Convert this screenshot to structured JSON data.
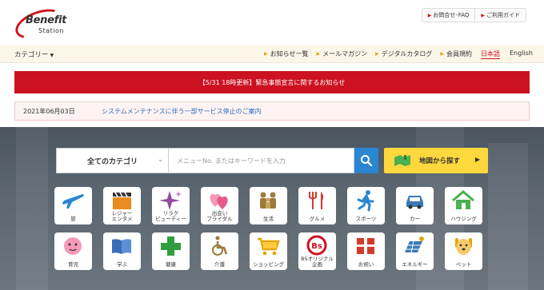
{
  "header": {
    "logo_main": "Benefit",
    "logo_sub": "Station",
    "links": [
      "お問合せ･FAQ",
      "ご利用ガイド"
    ]
  },
  "nav": {
    "category": "カテゴリー",
    "items": [
      "お知らせ一覧",
      "メールマガジン",
      "デジタルカタログ",
      "会員規約"
    ],
    "lang_ja": "日本語",
    "lang_en": "English"
  },
  "alert": {
    "text": "【5/31 18時更新】緊急事態宣言に関するお知らせ"
  },
  "notice": {
    "date": "2021年06月03日",
    "text": "システムメンテナンスに伴う一部サービス停止のご案内"
  },
  "search": {
    "category": "全てのカテゴリ",
    "placeholder": "メニューNo. またはキーワードを入力",
    "map_button": "地図から探す"
  },
  "categories": [
    {
      "label": "旅",
      "icon": "airplane-icon",
      "color": "#2a86d1"
    },
    {
      "label": "レジャー\nエンタメ",
      "icon": "clapperboard-icon",
      "color": "#e98b1e"
    },
    {
      "label": "リラク\nビューティー",
      "icon": "sparkle-icon",
      "color": "#8e4ba0"
    },
    {
      "label": "出会い\nブライダル",
      "icon": "hearts-icon",
      "color": "#e95a8c"
    },
    {
      "label": "生活",
      "icon": "family-icon",
      "color": "#9b7b3a"
    },
    {
      "label": "グルメ",
      "icon": "fork-knife-icon",
      "color": "#d33a2c"
    },
    {
      "label": "スポーツ",
      "icon": "runner-icon",
      "color": "#2a86d1"
    },
    {
      "label": "カー",
      "icon": "car-icon",
      "color": "#3a7ab8"
    },
    {
      "label": "ハウジング",
      "icon": "house-icon",
      "color": "#4caf50"
    },
    {
      "label": "育児",
      "icon": "baby-icon",
      "color": "#e95a8c"
    },
    {
      "label": "学ぶ",
      "icon": "book-icon",
      "color": "#3a6db8"
    },
    {
      "label": "健康",
      "icon": "cross-icon",
      "color": "#2e9e3e"
    },
    {
      "label": "介護",
      "icon": "wheelchair-icon",
      "color": "#9b7b3a"
    },
    {
      "label": "ショッピング",
      "icon": "cart-icon",
      "color": "#e6a400"
    },
    {
      "label": "BSオリジナル\n企画",
      "icon": "bs-logo-icon",
      "color": "#cc1121"
    },
    {
      "label": "お祝い",
      "icon": "gift-icon",
      "color": "#d33a2c"
    },
    {
      "label": "エネルギー",
      "icon": "solar-panel-icon",
      "color": "#3a7ab8"
    },
    {
      "label": "ペット",
      "icon": "dog-icon",
      "color": "#e6a400"
    }
  ]
}
